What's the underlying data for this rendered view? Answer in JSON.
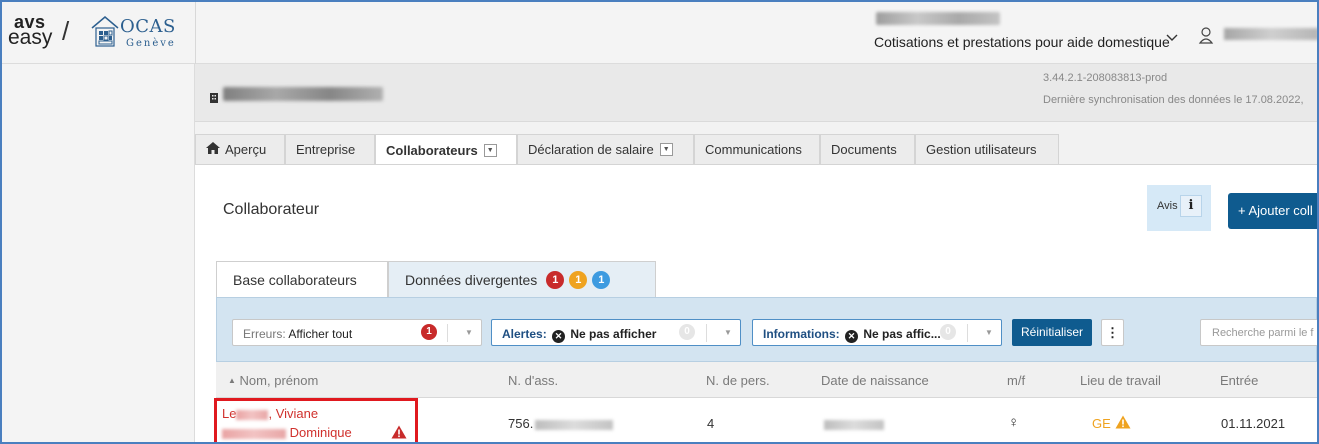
{
  "header": {
    "logo_avs_top": "avs",
    "logo_avs_bottom": "easy",
    "logo_slash": "/",
    "logo_ocas": "OCAS",
    "logo_ocas_sub": "Genève",
    "org_subtitle": "Cotisations et prestations pour aide domestique"
  },
  "entity": {
    "version": "3.44.2.1-208083813-prod",
    "sync": "Dernière synchronisation des données le 17.08.2022,"
  },
  "tabs": [
    {
      "label": "Aperçu",
      "icon": "home-icon"
    },
    {
      "label": "Entreprise"
    },
    {
      "label": "Collaborateurs",
      "active": true,
      "dropdown": true
    },
    {
      "label": "Déclaration de salaire",
      "dropdown": true
    },
    {
      "label": "Communications"
    },
    {
      "label": "Documents"
    },
    {
      "label": "Gestion utilisateurs"
    }
  ],
  "panel": {
    "title": "Collaborateur",
    "avis_label": "Avis",
    "avis_info": "i",
    "add_button": "+ Ajouter coll"
  },
  "subtabs": {
    "base": "Base collaborateurs",
    "divergent": "Données divergentes",
    "badges": [
      "1",
      "1",
      "1"
    ]
  },
  "filters": {
    "errors_label": "Erreurs:",
    "errors_value": "Afficher tout",
    "errors_count": "1",
    "alerts_label": "Alertes:",
    "alerts_value": "Ne pas afficher",
    "alerts_count": "0",
    "info_label": "Informations:",
    "info_value": "Ne pas affic...",
    "info_count": "0",
    "reset": "Réinitialiser",
    "more": "⋮",
    "search_placeholder": "Recherche parmi le f"
  },
  "table": {
    "columns": [
      "Nom, prénom",
      "N. d'ass.",
      "N. de pers.",
      "Date de naissance",
      "m/f",
      "Lieu de travail",
      "Entrée"
    ],
    "row": {
      "name1_visible_prefix": "Le",
      "name1_visible_suffix": ", Viviane",
      "name2_visible": "Dominique",
      "nass_prefix": "756.",
      "npers": "4",
      "gender": "♀",
      "lieu": "GE",
      "entree": "01.11.2021"
    }
  },
  "colors": {
    "primary": "#0f5b8f",
    "error": "#c82b2b",
    "warning": "#efa320",
    "info": "#3e9be0",
    "highlight": "#e0191f"
  }
}
